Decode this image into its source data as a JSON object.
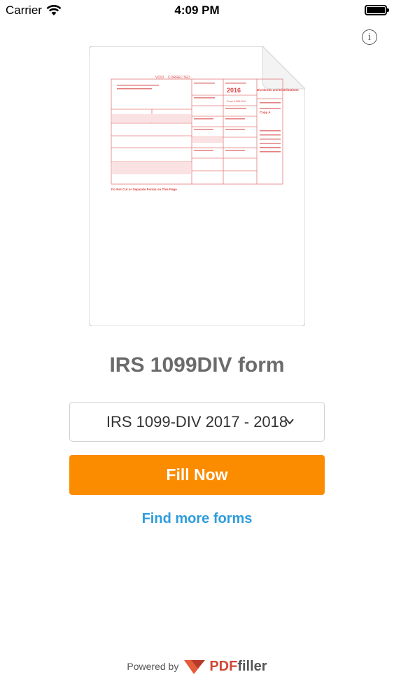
{
  "status_bar": {
    "carrier": "Carrier",
    "time": "4:09 PM"
  },
  "info": {
    "glyph": "i"
  },
  "form_preview": {
    "void_label": "VOID",
    "corrected_label": "CORRECTED",
    "year": "2016",
    "form_name": "Form 1099-DIV",
    "form_title": "Dividends and Distributions",
    "copy_label": "Copy A",
    "footer_note": "Do Not Cut or Separate Forms on This Page"
  },
  "form_title": "IRS 1099DIV form",
  "form_select": {
    "selected": "IRS 1099-DIV 2017 - 2018"
  },
  "fill_button": {
    "label": "Fill Now"
  },
  "find_more": {
    "label": "Find more forms"
  },
  "footer": {
    "powered_by": "Powered by",
    "brand_pdf": "PDF",
    "brand_filler": "filler"
  },
  "colors": {
    "accent": "#fb8c00",
    "link": "#2d9cdb",
    "form_red": "#e05050"
  }
}
